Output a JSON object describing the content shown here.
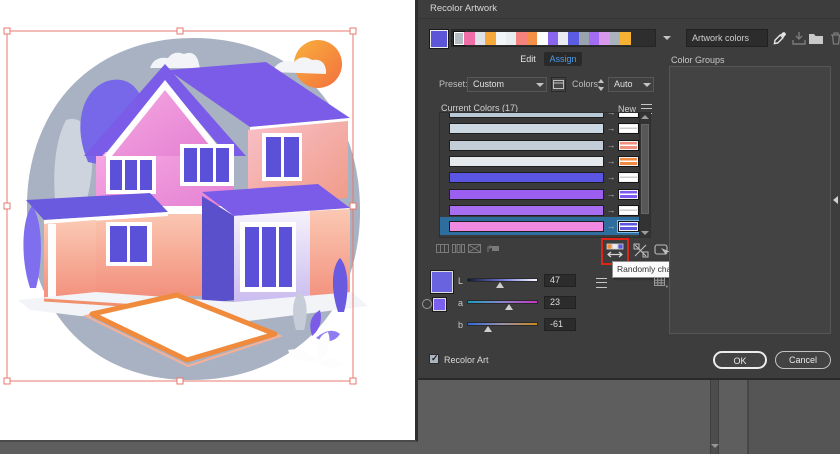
{
  "dialog": {
    "title": "Recolor Artwork",
    "header": {
      "active_color": "#5c55d8",
      "strip_swatches": [
        "#b4bcc4",
        "#f06ea8",
        "#dde3e8",
        "#f6a93a",
        "#f2f4f6",
        "#e9edf0",
        "#f4837e",
        "#f49046",
        "#ffffff",
        "#8a66f0",
        "#e8ecf0",
        "#5c5ce0",
        "#9aa4ae",
        "#a36cf2",
        "#d898ec",
        "#aab2bc",
        "#f7b133"
      ],
      "library_name": "Artwork colors"
    },
    "tabs": {
      "edit": "Edit",
      "assign": "Assign"
    },
    "controls": {
      "preset_label": "Preset:",
      "preset_value": "Custom",
      "colors_label": "Colors:",
      "colors_value": "Auto"
    },
    "assign": {
      "current_colors_label": "Current Colors (17)",
      "new_label": "New",
      "rows": [
        {
          "current": "#b9c9d6",
          "new": "#ffffff",
          "selected": false
        },
        {
          "current": "#ccd9e2",
          "new": "#ffffff",
          "selected": false
        },
        {
          "current": "#c2cdd8",
          "new": "#f2907e",
          "selected": false
        },
        {
          "current": "#e3e9ed",
          "new": "#f08a42",
          "selected": false
        },
        {
          "current": "#5a55e2",
          "new": "#ffffff",
          "selected": false
        },
        {
          "current": "#9a5ff0",
          "new": "#7d5bf0",
          "selected": false
        },
        {
          "current": "#a76ef2",
          "new": "#ffffff",
          "selected": false
        },
        {
          "current": "#f08ae0",
          "new": "#5b55e0",
          "selected": true
        }
      ]
    },
    "sliders": {
      "current_swatch": "#6a63e0",
      "linked_swatch": "#7a5ff0",
      "rows": [
        {
          "label": "L",
          "value": "47",
          "pos": 0.46,
          "stops": [
            "#141838",
            "#7076d8",
            "#ffffff"
          ]
        },
        {
          "label": "a",
          "value": "23",
          "pos": 0.6,
          "stops": [
            "#1d9ac0",
            "#8a86c8",
            "#c832c8"
          ]
        },
        {
          "label": "b",
          "value": "-61",
          "pos": 0.27,
          "stops": [
            "#2f6cd8",
            "#9a90a8",
            "#c8881e"
          ]
        }
      ]
    },
    "tooltip": "Randomly change color order",
    "color_groups": {
      "label": "Color Groups"
    },
    "footer": {
      "recolor_art_label": "Recolor Art",
      "ok_label": "OK",
      "cancel_label": "Cancel"
    }
  },
  "annotation": {
    "highlight_color": "#e2231a",
    "highlighted_control": "randomly-change-color-order"
  },
  "artwork": {
    "selection_color": "#e8786c",
    "palette": [
      "#a9b2c2",
      "#7a5ce8",
      "#ee8ad5",
      "#f2907c",
      "#5b50d8",
      "#f08a3c",
      "#6a5ae0",
      "#ffffff"
    ]
  }
}
